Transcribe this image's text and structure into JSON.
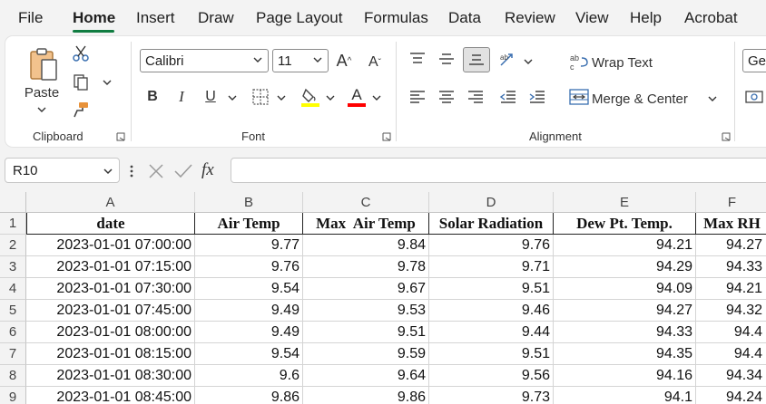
{
  "menu": {
    "items": [
      "File",
      "Home",
      "Insert",
      "Draw",
      "Page Layout",
      "Formulas",
      "Data",
      "Review",
      "View",
      "Help",
      "Acrobat"
    ],
    "active": "Home"
  },
  "ribbon": {
    "clipboard": {
      "paste_label": "Paste",
      "group_label": "Clipboard"
    },
    "font": {
      "font_name": "Calibri",
      "font_size": "11",
      "group_label": "Font",
      "bold": "B",
      "italic": "I",
      "underline": "U",
      "increase_size": "A",
      "decrease_size": "A",
      "font_color": "A",
      "highlight_color": "#ffff00",
      "font_color_value": "#ff0000"
    },
    "alignment": {
      "wrap_text": "Wrap Text",
      "merge_center": "Merge & Center",
      "group_label": "Alignment"
    },
    "number": {
      "format_value": "Gen"
    }
  },
  "formula_bar": {
    "name_box": "R10",
    "fx": "fx",
    "formula": ""
  },
  "sheet": {
    "columns": [
      "A",
      "B",
      "C",
      "D",
      "E",
      "F"
    ],
    "row_numbers": [
      "1",
      "2",
      "3",
      "4",
      "5",
      "6",
      "7",
      "8",
      "9"
    ],
    "header": [
      "date",
      "Air Temp",
      "Max  Air Temp",
      "Solar Radiation",
      "Dew Pt. Temp.",
      "Max RH"
    ],
    "rows": [
      [
        "2023-01-01 07:00:00",
        "9.77",
        "9.84",
        "9.76",
        "94.21",
        "94.27"
      ],
      [
        "2023-01-01 07:15:00",
        "9.76",
        "9.78",
        "9.71",
        "94.29",
        "94.33"
      ],
      [
        "2023-01-01 07:30:00",
        "9.54",
        "9.67",
        "9.51",
        "94.09",
        "94.21"
      ],
      [
        "2023-01-01 07:45:00",
        "9.49",
        "9.53",
        "9.46",
        "94.27",
        "94.32"
      ],
      [
        "2023-01-01 08:00:00",
        "9.49",
        "9.51",
        "9.44",
        "94.33",
        "94.4"
      ],
      [
        "2023-01-01 08:15:00",
        "9.54",
        "9.59",
        "9.51",
        "94.35",
        "94.4"
      ],
      [
        "2023-01-01 08:30:00",
        "9.6",
        "9.64",
        "9.56",
        "94.16",
        "94.34"
      ],
      [
        "2023-01-01 08:45:00",
        "9.86",
        "9.86",
        "9.73",
        "94.1",
        "94.24"
      ]
    ]
  }
}
